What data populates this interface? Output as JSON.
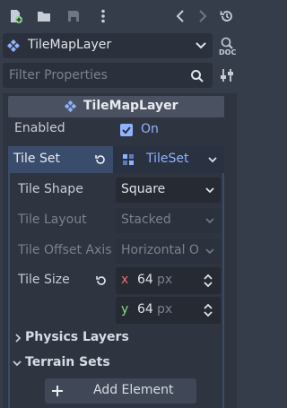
{
  "node_selector": {
    "name": "TileMapLayer"
  },
  "filter": {
    "placeholder": "Filter Properties"
  },
  "inspector": {
    "title": "TileMapLayer"
  },
  "props": {
    "enabled": {
      "label": "Enabled",
      "value": "On",
      "checked": true
    },
    "tile_set": {
      "label": "Tile Set",
      "value": "TileSet"
    },
    "tile_shape": {
      "label": "Tile Shape",
      "value": "Square"
    },
    "tile_layout": {
      "label": "Tile Layout",
      "value": "Stacked"
    },
    "tile_offset_axis": {
      "label": "Tile Offset Axis",
      "value": "Horizontal O"
    },
    "tile_size": {
      "label": "Tile Size",
      "x_label": "x",
      "x_value": "64",
      "y_label": "y",
      "y_value": "64",
      "unit": "px"
    }
  },
  "sections": {
    "physics_layers": "Physics Layers",
    "terrain_sets": "Terrain Sets"
  },
  "add_element": {
    "label": "Add Element"
  },
  "doc_icon_label": "DOC",
  "colors": {
    "accent": "#8fb4ff",
    "x_axis": "#e8716f",
    "y_axis": "#8ed98a",
    "tileset_bg": "#3a4c6b"
  }
}
